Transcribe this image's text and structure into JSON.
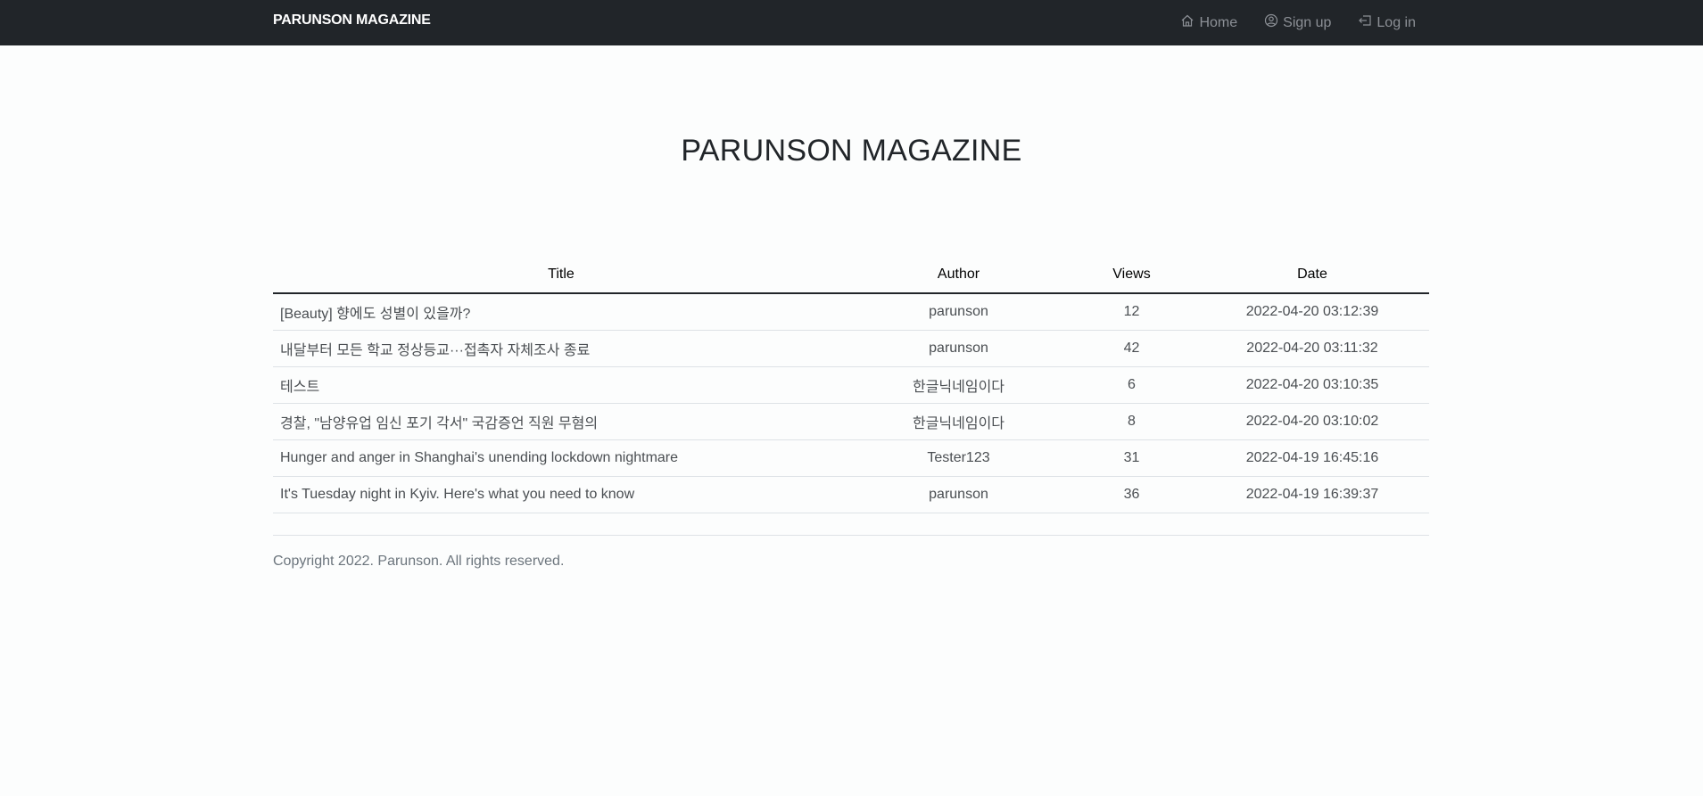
{
  "nav": {
    "brand": "PARUNSON MAGAZINE",
    "links": [
      {
        "label": "Home",
        "icon": "house-icon"
      },
      {
        "label": "Sign up",
        "icon": "user-circle-icon"
      },
      {
        "label": "Log in",
        "icon": "login-icon"
      }
    ]
  },
  "hero": {
    "title": "PARUNSON MAGAZINE"
  },
  "table": {
    "headers": [
      "Title",
      "Author",
      "Views",
      "Date"
    ],
    "rows": [
      {
        "title": "[Beauty] 향에도 성별이 있을까?",
        "author": "parunson",
        "views": "12",
        "date": "2022-04-20 03:12:39"
      },
      {
        "title": "내달부터 모든 학교 정상등교···접촉자 자체조사 종료",
        "author": "parunson",
        "views": "42",
        "date": "2022-04-20 03:11:32"
      },
      {
        "title": "테스트",
        "author": "한글닉네임이다",
        "views": "6",
        "date": "2022-04-20 03:10:35"
      },
      {
        "title": "경찰, \"남양유업 임신 포기 각서\" 국감증언 직원 무혐의",
        "author": "한글닉네임이다",
        "views": "8",
        "date": "2022-04-20 03:10:02"
      },
      {
        "title": "Hunger and anger in Shanghai's unending lockdown nightmare",
        "author": "Tester123",
        "views": "31",
        "date": "2022-04-19 16:45:16"
      },
      {
        "title": "It's Tuesday night in Kyiv. Here's what you need to know",
        "author": "parunson",
        "views": "36",
        "date": "2022-04-19 16:39:37"
      }
    ]
  },
  "footer": {
    "copyright": "Copyright 2022. Parunson. All rights reserved."
  },
  "colors": {
    "navbar_bg": "#212529",
    "nav_link": "#8c9096",
    "page_bg": "#fcfdfd"
  }
}
